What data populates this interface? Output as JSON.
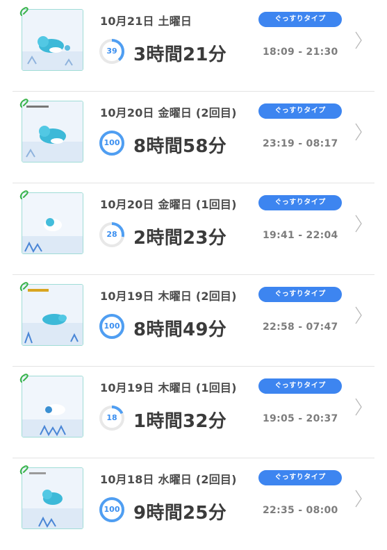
{
  "colors": {
    "accent": "#3d85f0",
    "ring_track": "#e8e8e8",
    "ring_fill": "#4f9ef2",
    "thumb_border": "#9fdcd6"
  },
  "records": [
    {
      "date": "10月21日 土曜日",
      "type_label": "ぐっすりタイプ",
      "score": 39,
      "duration": "3時間21分",
      "time_range": "18:09 - 21:30"
    },
    {
      "date": "10月20日 金曜日 (2回目)",
      "type_label": "ぐっすりタイプ",
      "score": 100,
      "duration": "8時間58分",
      "time_range": "23:19 - 08:17"
    },
    {
      "date": "10月20日 金曜日 (1回目)",
      "type_label": "ぐっすりタイプ",
      "score": 28,
      "duration": "2時間23分",
      "time_range": "19:41 - 22:04"
    },
    {
      "date": "10月19日 木曜日 (2回目)",
      "type_label": "ぐっすりタイプ",
      "score": 100,
      "duration": "8時間49分",
      "time_range": "22:58 - 07:47"
    },
    {
      "date": "10月19日 木曜日 (1回目)",
      "type_label": "ぐっすりタイプ",
      "score": 18,
      "duration": "1時間32分",
      "time_range": "19:05 - 20:37"
    },
    {
      "date": "10月18日 水曜日 (2回目)",
      "type_label": "ぐっすりタイプ",
      "score": 100,
      "duration": "9時間25分",
      "time_range": "22:35 - 08:00"
    }
  ]
}
